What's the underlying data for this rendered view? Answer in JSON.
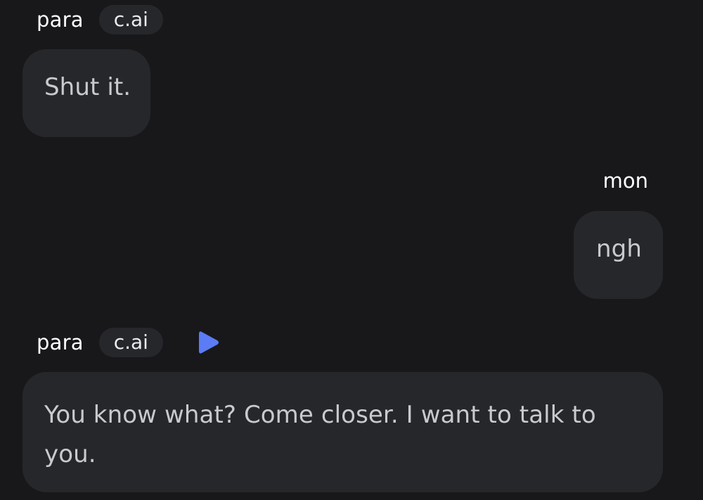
{
  "messages": [
    {
      "sender": "para",
      "badge": "c.ai",
      "text": "Shut it."
    },
    {
      "sender": "mon",
      "text": "ngh"
    },
    {
      "sender": "para",
      "badge": "c.ai",
      "has_play_icon": true,
      "text": "You know what? Come closer. I want to talk to you."
    }
  ],
  "icons": {
    "play": "play-icon"
  },
  "colors": {
    "background": "#18181b",
    "bubble": "#26272b",
    "accent": "#5b7cf5",
    "text_primary": "#ffffff",
    "text_message": "#c9c9cf"
  }
}
